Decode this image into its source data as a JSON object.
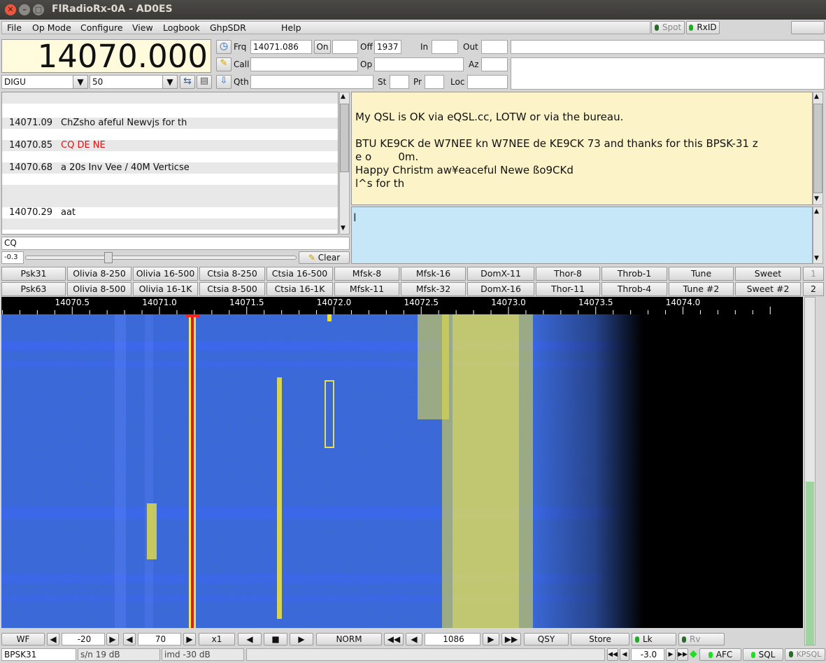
{
  "window": {
    "title": "FlRadioRx-0A - AD0ES"
  },
  "menu": [
    "File",
    "Op Mode",
    "Configure",
    "View",
    "Logbook",
    "GhpSDR",
    "Help"
  ],
  "top_right": {
    "spot": "Spot",
    "rxid": "RxID"
  },
  "freq_display": "14070.000",
  "mode_select": "DIGU",
  "bw_select": "50",
  "log": {
    "frq_label": "Frq",
    "frq_value": "14071.086",
    "on_label": "On",
    "off_label": "Off",
    "off_value": "1937",
    "in_label": "In",
    "out_label": "Out",
    "call_label": "Call",
    "op_label": "Op",
    "az_label": "Az",
    "qth_label": "Qth",
    "st_label": "St",
    "pr_label": "Pr",
    "loc_label": "Loc"
  },
  "rx_list": [
    {
      "freq": "14071.09",
      "msg": "ChZsho afeful Newvjs for th",
      "color": "#111111"
    },
    {
      "freq": "14070.85",
      "msg": "CQ DE NE",
      "color": "#dd1111"
    },
    {
      "freq": "14070.68",
      "msg": "a 20s Inv Vee / 40M Verticse",
      "color": "#111111"
    },
    {
      "freq": "14070.29",
      "msg": "aat",
      "color": "#111111"
    }
  ],
  "search_value": "CQ",
  "squelch_value": "-0.3",
  "clear_label": "Clear",
  "rx_text": [
    "My QSL is OK via eQSL.cc, LOTW or via the bureau.",
    "",
    "BTU KE9CK de W7NEE kn W7NEE de KE9CK 73 and thanks for this BPSK-31 z",
    "e o        0m.",
    "Happy Christm  aw¥eaceful Newe ßo9CKd",
    "l^s for th"
  ],
  "macros_row1": [
    "Psk31",
    "Olivia 8-250",
    "Olivia 16-500",
    "Ctsia 8-250",
    "Ctsia 16-500",
    "Mfsk-8",
    "Mfsk-16",
    "DomX-11",
    "Thor-8",
    "Throb-1",
    "Tune",
    "Sweet"
  ],
  "macros_row2": [
    "Psk63",
    "Olivia 8-500",
    "Olivia 16-1K",
    "Ctsia 8-500",
    "Ctsia 16-1K",
    "Mfsk-11",
    "Mfsk-32",
    "DomX-16",
    "Thor-11",
    "Throb-4",
    "Tune #2",
    "Sweet #2"
  ],
  "macro_set_1": "1",
  "macro_set_2": "2",
  "ruler_ticks": [
    "14070.5",
    "14071.0",
    "14071.5",
    "14072.0",
    "14072.5",
    "14073.0",
    "14073.5",
    "14074.0"
  ],
  "wf_controls": {
    "wf": "WF",
    "ref": "-20",
    "range": "70",
    "zoom": "x1",
    "norm": "NORM",
    "carrier": "1086",
    "qsy": "QSY",
    "store": "Store",
    "lk": "Lk",
    "rv": "Rv"
  },
  "status": {
    "mode": "BPSK31",
    "snr": "s/n 19 dB",
    "imd": "imd -30 dB",
    "sql_value": "-3.0",
    "afc": "AFC",
    "sql": "SQL",
    "kpsql": "KPSQL"
  },
  "colors": {
    "led_green": "#22dd22",
    "led_dim": "#2a6a2a",
    "wf_signal": "#e8e040",
    "wf_bg": "#1030c0"
  }
}
